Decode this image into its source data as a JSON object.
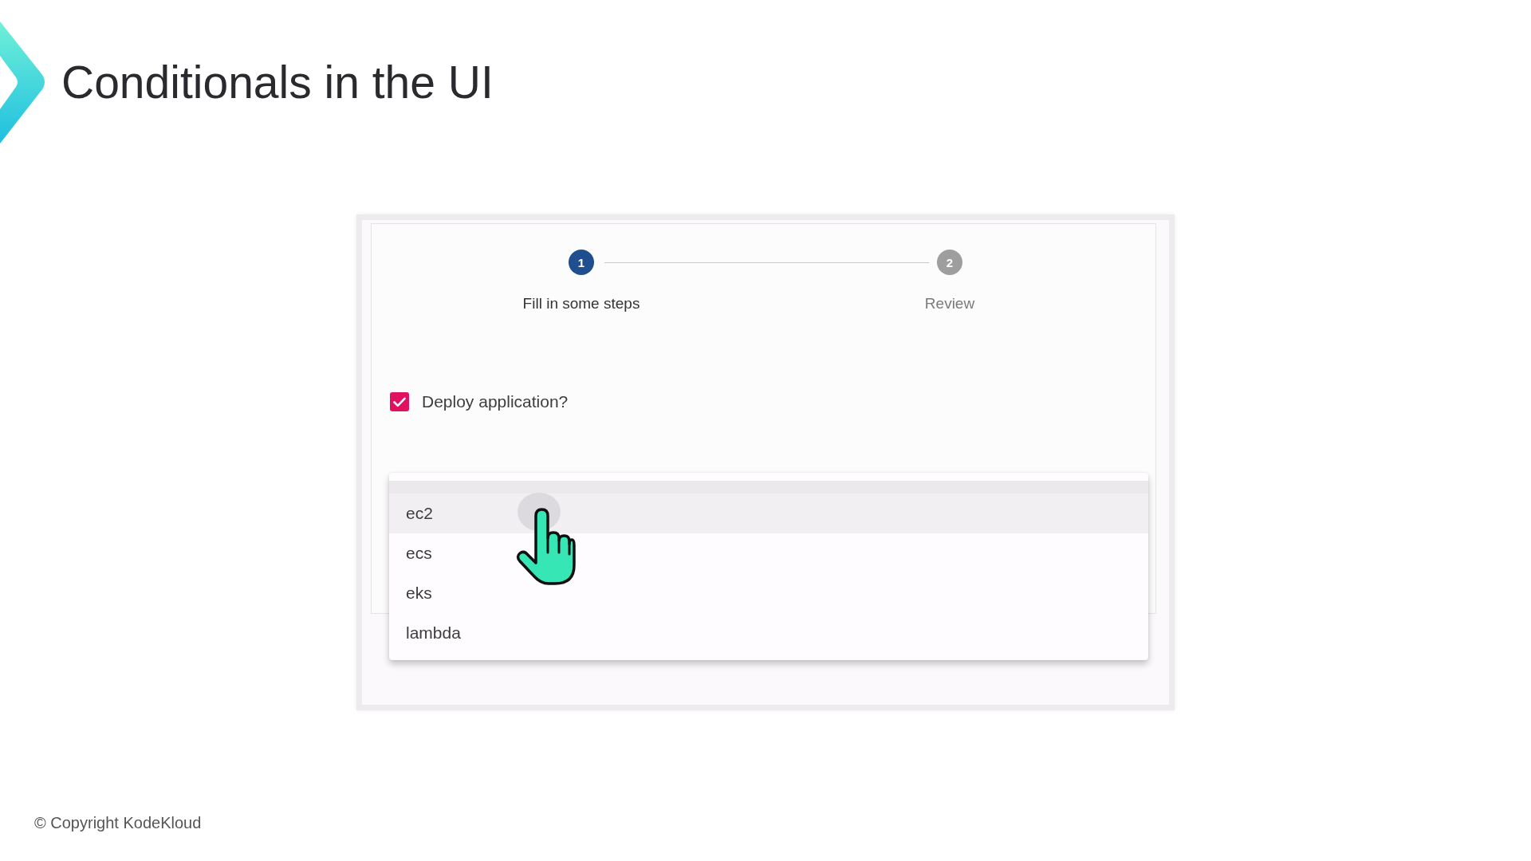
{
  "slide": {
    "title": "Conditionals in the UI",
    "footer": "© Copyright KodeKloud"
  },
  "stepper": {
    "steps": [
      {
        "number": "1",
        "label": "Fill in some steps",
        "active": true
      },
      {
        "number": "2",
        "label": "Review",
        "active": false
      }
    ]
  },
  "checkbox": {
    "label": "Deploy application?",
    "checked": true
  },
  "dropdown_menu": {
    "options": [
      {
        "label": "ec2",
        "highlighted": true
      },
      {
        "label": "ecs",
        "highlighted": false
      },
      {
        "label": "eks",
        "highlighted": false
      },
      {
        "label": "lambda",
        "highlighted": false
      }
    ]
  }
}
